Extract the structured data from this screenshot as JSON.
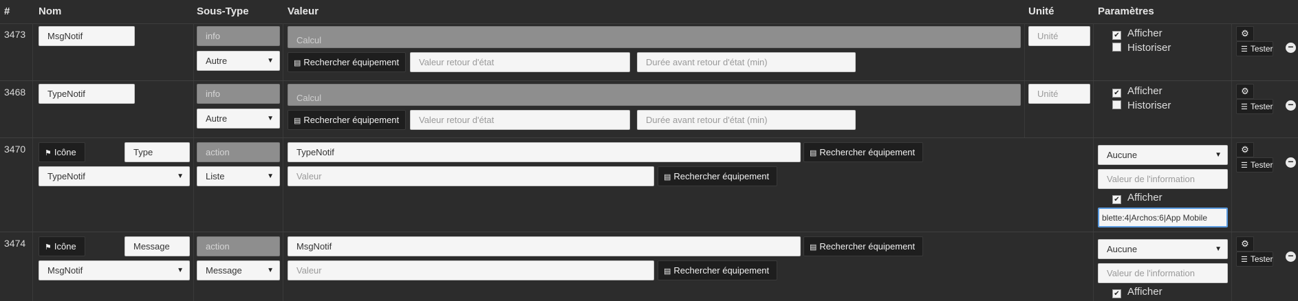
{
  "header": {
    "col_id": "#",
    "col_nom": "Nom",
    "col_soustype": "Sous-Type",
    "col_valeur": "Valeur",
    "col_unite": "Unité",
    "col_params": "Paramètres"
  },
  "labels": {
    "rechercher": "Rechercher équipement",
    "icone": "Icône",
    "tester": "Tester",
    "afficher": "Afficher",
    "historiser": "Historiser",
    "calcul": "Calcul",
    "unite": "Unité",
    "valeur_retour": "Valeur retour d'état",
    "duree_retour": "Durée avant retour d'état (min)",
    "valeur": "Valeur",
    "valeur_info": "Valeur de l'information"
  },
  "rows": [
    {
      "id": "3473",
      "name": "MsgNotif",
      "type": "info",
      "subtype": "Autre",
      "afficher": true,
      "historiser": false
    },
    {
      "id": "3468",
      "name": "TypeNotif",
      "type": "info",
      "subtype": "Autre",
      "afficher": true,
      "historiser": false
    },
    {
      "id": "3470",
      "name": "Type",
      "type": "action",
      "subtype": "Liste",
      "value_cmd": "TypeNotif",
      "linked_info": "TypeNotif",
      "param_select": "Aucune",
      "afficher": true,
      "list_value": "blette:4|Archos:6|App Mobile"
    },
    {
      "id": "3474",
      "name": "Message",
      "type": "action",
      "subtype": "Message",
      "value_cmd": "MsgNotif",
      "linked_info": "MsgNotif",
      "param_select": "Aucune",
      "afficher": true
    }
  ],
  "icons": {
    "flag": "flag-icon",
    "list": "list-icon",
    "cogs": "cogs-icon",
    "rss": "rss-icon",
    "minus": "minus-circle-icon"
  }
}
